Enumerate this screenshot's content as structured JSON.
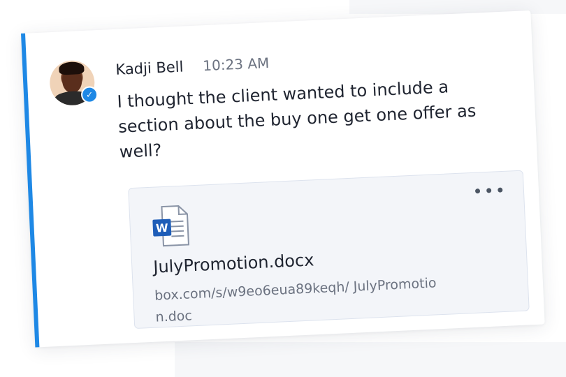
{
  "message": {
    "author": "Kadji Bell",
    "timestamp": "10:23 AM",
    "text": "I thought the client wanted to include a section about the buy one get one offer as well?",
    "verified": true
  },
  "attachment": {
    "file_name": "JulyPromotion.docx",
    "link": "box.com/s/w9eo6eua89keqh/ JulyPromotion.doc",
    "icon": "word-doc-icon",
    "more": "more-options-icon"
  },
  "colors": {
    "accent": "#1e88e5",
    "word_blue": "#1e5db8"
  }
}
